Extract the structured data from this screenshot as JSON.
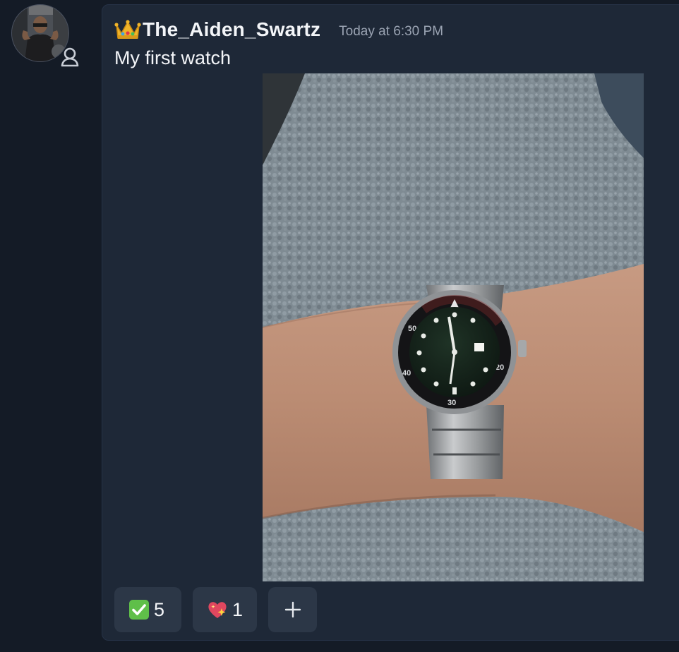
{
  "message": {
    "author": "The_Aiden_Swartz",
    "timestamp": "Today at 6:30 PM",
    "text": "My first watch",
    "author_badge_icon": "crown-icon",
    "presence_icon": "person-icon",
    "attachment": {
      "type": "image",
      "subject": "wristwatch"
    }
  },
  "reactions": [
    {
      "emoji": "check-mark-button-icon",
      "count": "5"
    },
    {
      "emoji": "sparkling-heart-icon",
      "count": "1"
    }
  ],
  "add_reaction": {
    "icon": "plus-icon",
    "label": "+"
  },
  "colors": {
    "background": "#141b26",
    "card": "#1e2837",
    "reaction_bg": "#2c3747",
    "text": "#f3f5f8",
    "muted": "#9aa3b2"
  }
}
